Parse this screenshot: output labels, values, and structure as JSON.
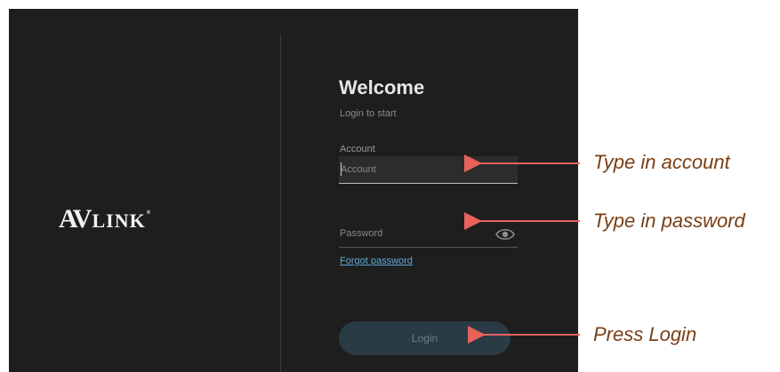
{
  "brand": {
    "logo_av": "AV",
    "logo_link": "LINK",
    "logo_mark": "®"
  },
  "login": {
    "title": "Welcome",
    "subtitle": "Login to start",
    "account_label": "Account",
    "account_placeholder": "Account",
    "password_placeholder": "Password",
    "forgot_label": "Forgot password",
    "login_button": "Login"
  },
  "annotations": {
    "account_note": "Type in account",
    "password_note": "Type in password",
    "login_note": "Press Login",
    "arrow_color": "#e8615b",
    "note_color": "#7a3e14"
  },
  "colors": {
    "panel_bg": "#1e1e1e",
    "link": "#5fa8d6",
    "button_bg": "#2a3b45"
  },
  "icons": {
    "password_toggle": "eye-icon"
  }
}
